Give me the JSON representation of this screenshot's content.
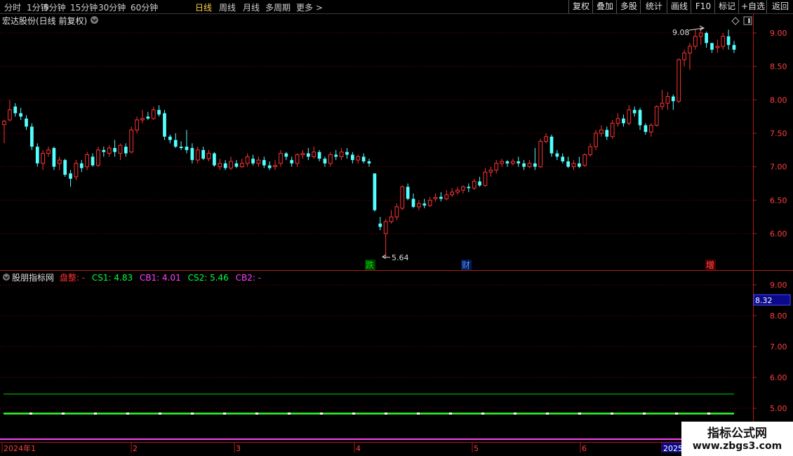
{
  "toolbar": {
    "timeframes": [
      {
        "label": "分时",
        "active": false
      },
      {
        "label": "1分钟",
        "active": false
      },
      {
        "label": "5分钟",
        "active": false
      },
      {
        "label": "15分钟",
        "active": false
      },
      {
        "label": "30分钟",
        "active": false
      },
      {
        "label": "60分钟",
        "active": false
      },
      {
        "label": "日线",
        "active": true
      },
      {
        "label": "周线",
        "active": false
      },
      {
        "label": "月线",
        "active": false
      },
      {
        "label": "多周期",
        "active": false
      },
      {
        "label": "更多 >",
        "active": false
      }
    ],
    "right_buttons": [
      "复权",
      "叠加",
      "多股",
      "统计",
      "画线",
      "F10",
      "+自选",
      "返回"
    ],
    "mark_label": "标记"
  },
  "main_panel": {
    "title": "宏达股份(日线 前复权)",
    "y_ticks": [
      "9.00",
      "8.50",
      "8.00",
      "7.50",
      "7.00",
      "6.50",
      "6.00"
    ],
    "high_annotation": "9.08",
    "low_annotation": "5.64",
    "markers": [
      {
        "text": "跌",
        "color": "#00c000"
      },
      {
        "text": "财",
        "color": "#2a6cff"
      },
      {
        "text": "增",
        "color": "#ff3030"
      }
    ]
  },
  "indicator_panel": {
    "name": "股朋指标网",
    "label_pan": "盘整:",
    "label_cs1": "CS1: 4.83",
    "label_cb1": "CB1: 4.01",
    "label_cs2": "CS2: 5.46",
    "label_cb2": "CB2:",
    "dash": "-",
    "y_ticks": [
      "9.00",
      "8.00",
      "7.00",
      "6.00",
      "5.00"
    ],
    "current_value": "8.32"
  },
  "x_axis": {
    "labels": [
      "2024年1",
      "2",
      "3",
      "4",
      "5",
      "6",
      "2025"
    ]
  },
  "watermark": {
    "line1": "指标公式网",
    "line2": "www.zbgs3.com"
  },
  "colors": {
    "up": "#ff3232",
    "down": "#54ffff",
    "grid": "#8b0000",
    "green_line": "#00d000",
    "magenta_line": "#ff40ff"
  },
  "chart_data": {
    "type": "candlestick",
    "y_range": [
      5.55,
      9.25
    ],
    "candles": [
      [
        7.63,
        7.68,
        7.35,
        7.7
      ],
      [
        7.7,
        7.85,
        7.68,
        8.0
      ],
      [
        7.9,
        7.8,
        7.75,
        7.95
      ],
      [
        7.8,
        7.75,
        7.7,
        7.88
      ],
      [
        7.72,
        7.6,
        7.55,
        7.77
      ],
      [
        7.6,
        7.3,
        7.25,
        7.65
      ],
      [
        7.3,
        7.05,
        7.0,
        7.35
      ],
      [
        7.05,
        7.2,
        6.95,
        7.25
      ],
      [
        7.2,
        7.25,
        7.15,
        7.3
      ],
      [
        7.28,
        7.0,
        6.95,
        7.3
      ],
      [
        7.05,
        7.1,
        6.95,
        7.15
      ],
      [
        7.1,
        6.88,
        6.85,
        7.12
      ],
      [
        6.9,
        6.82,
        6.7,
        6.95
      ],
      [
        6.85,
        7.05,
        6.8,
        7.1
      ],
      [
        7.05,
        6.98,
        6.92,
        7.1
      ],
      [
        7.0,
        7.18,
        6.95,
        7.22
      ],
      [
        7.15,
        7.02,
        7.0,
        7.2
      ],
      [
        7.02,
        7.25,
        7.0,
        7.3
      ],
      [
        7.25,
        7.22,
        7.15,
        7.3
      ],
      [
        7.2,
        7.28,
        7.15,
        7.32
      ],
      [
        7.28,
        7.22,
        7.15,
        7.4
      ],
      [
        7.2,
        7.32,
        7.1,
        7.35
      ],
      [
        7.3,
        7.2,
        7.15,
        7.35
      ],
      [
        7.22,
        7.55,
        7.2,
        7.6
      ],
      [
        7.55,
        7.7,
        7.5,
        7.75
      ],
      [
        7.7,
        7.72,
        7.65,
        7.85
      ],
      [
        7.75,
        7.72,
        7.7,
        7.82
      ],
      [
        7.72,
        7.85,
        7.7,
        7.9
      ],
      [
        7.85,
        7.78,
        7.75,
        7.92
      ],
      [
        7.8,
        7.45,
        7.4,
        7.85
      ],
      [
        7.45,
        7.4,
        7.35,
        7.48
      ],
      [
        7.4,
        7.3,
        7.28,
        7.5
      ],
      [
        7.3,
        7.28,
        7.25,
        7.38
      ],
      [
        7.3,
        7.25,
        7.2,
        7.55
      ],
      [
        7.28,
        7.1,
        7.05,
        7.35
      ],
      [
        7.1,
        7.25,
        7.05,
        7.3
      ],
      [
        7.25,
        7.12,
        7.1,
        7.3
      ],
      [
        7.12,
        7.2,
        7.08,
        7.25
      ],
      [
        7.2,
        7.02,
        7.0,
        7.22
      ],
      [
        7.0,
        7.05,
        6.95,
        7.12
      ],
      [
        7.05,
        6.98,
        6.95,
        7.1
      ],
      [
        6.98,
        7.08,
        6.95,
        7.15
      ],
      [
        7.05,
        7.0,
        6.98,
        7.1
      ],
      [
        7.0,
        7.05,
        6.98,
        7.12
      ],
      [
        7.05,
        7.15,
        7.0,
        7.2
      ],
      [
        7.12,
        7.05,
        7.02,
        7.18
      ],
      [
        7.05,
        7.1,
        7.0,
        7.15
      ],
      [
        7.1,
        7.02,
        6.98,
        7.15
      ],
      [
        7.02,
        6.98,
        6.95,
        7.08
      ],
      [
        7.0,
        7.02,
        6.95,
        7.1
      ],
      [
        7.05,
        7.2,
        7.0,
        7.25
      ],
      [
        7.2,
        7.15,
        7.1,
        7.22
      ],
      [
        7.1,
        7.05,
        7.0,
        7.15
      ],
      [
        7.05,
        7.18,
        7.0,
        7.2
      ],
      [
        7.18,
        7.2,
        7.12,
        7.25
      ],
      [
        7.2,
        7.15,
        7.1,
        7.28
      ],
      [
        7.15,
        7.22,
        7.12,
        7.3
      ],
      [
        7.22,
        7.12,
        7.08,
        7.25
      ],
      [
        7.12,
        7.05,
        7.0,
        7.15
      ],
      [
        7.05,
        7.18,
        7.0,
        7.22
      ],
      [
        7.18,
        7.15,
        7.1,
        7.25
      ],
      [
        7.15,
        7.22,
        7.1,
        7.28
      ],
      [
        7.22,
        7.18,
        7.12,
        7.28
      ],
      [
        7.18,
        7.1,
        7.05,
        7.22
      ],
      [
        7.1,
        7.15,
        7.05,
        7.18
      ],
      [
        7.15,
        7.08,
        7.05,
        7.2
      ],
      [
        7.08,
        7.05,
        7.0,
        7.12
      ],
      [
        6.9,
        6.35,
        6.33,
        6.9
      ],
      [
        6.15,
        6.1,
        6.05,
        6.25
      ],
      [
        6.0,
        6.18,
        5.64,
        6.22
      ],
      [
        6.18,
        6.25,
        6.15,
        6.35
      ],
      [
        6.25,
        6.4,
        6.2,
        6.45
      ],
      [
        6.38,
        6.7,
        6.35,
        6.72
      ],
      [
        6.7,
        6.52,
        6.5,
        6.75
      ],
      [
        6.52,
        6.4,
        6.38,
        6.6
      ],
      [
        6.4,
        6.45,
        6.35,
        6.5
      ],
      [
        6.45,
        6.42,
        6.38,
        6.52
      ],
      [
        6.42,
        6.5,
        6.4,
        6.55
      ],
      [
        6.52,
        6.54,
        6.48,
        6.6
      ],
      [
        6.55,
        6.52,
        6.48,
        6.62
      ],
      [
        6.52,
        6.58,
        6.5,
        6.65
      ],
      [
        6.58,
        6.62,
        6.55,
        6.68
      ],
      [
        6.62,
        6.65,
        6.58,
        6.7
      ],
      [
        6.65,
        6.7,
        6.6,
        6.72
      ],
      [
        6.7,
        6.68,
        6.62,
        6.75
      ],
      [
        6.68,
        6.78,
        6.65,
        6.82
      ],
      [
        6.78,
        6.72,
        6.7,
        6.85
      ],
      [
        6.72,
        6.92,
        6.7,
        6.98
      ],
      [
        6.92,
        6.95,
        6.85,
        7.0
      ],
      [
        6.95,
        7.05,
        6.9,
        7.1
      ],
      [
        7.05,
        7.08,
        7.0,
        7.12
      ],
      [
        7.08,
        7.05,
        7.0,
        7.1
      ],
      [
        7.05,
        7.08,
        7.02,
        7.12
      ],
      [
        7.08,
        7.05,
        7.0,
        7.15
      ],
      [
        7.05,
        7.0,
        6.95,
        7.1
      ],
      [
        7.0,
        7.05,
        6.98,
        7.1
      ],
      [
        7.05,
        7.0,
        6.95,
        7.28
      ],
      [
        7.0,
        7.38,
        6.98,
        7.42
      ],
      [
        7.38,
        7.45,
        7.35,
        7.5
      ],
      [
        7.45,
        7.2,
        7.15,
        7.48
      ],
      [
        7.2,
        7.15,
        7.1,
        7.25
      ],
      [
        7.15,
        7.08,
        7.05,
        7.2
      ],
      [
        7.08,
        7.0,
        6.98,
        7.15
      ],
      [
        7.0,
        7.05,
        6.95,
        7.1
      ],
      [
        7.05,
        7.0,
        6.98,
        7.15
      ],
      [
        7.02,
        7.18,
        7.0,
        7.2
      ],
      [
        7.18,
        7.3,
        7.15,
        7.35
      ],
      [
        7.3,
        7.5,
        7.25,
        7.55
      ],
      [
        7.5,
        7.55,
        7.45,
        7.62
      ],
      [
        7.55,
        7.45,
        7.4,
        7.6
      ],
      [
        7.45,
        7.65,
        7.42,
        7.7
      ],
      [
        7.65,
        7.72,
        7.6,
        7.8
      ],
      [
        7.72,
        7.65,
        7.6,
        7.78
      ],
      [
        7.65,
        7.85,
        7.62,
        7.92
      ],
      [
        7.85,
        7.8,
        7.75,
        7.9
      ],
      [
        7.85,
        7.62,
        7.55,
        7.88
      ],
      [
        7.62,
        7.52,
        7.48,
        7.65
      ],
      [
        7.52,
        7.62,
        7.45,
        7.65
      ],
      [
        7.62,
        7.9,
        7.6,
        7.92
      ],
      [
        7.9,
        7.95,
        7.85,
        8.15
      ],
      [
        7.95,
        8.05,
        7.85,
        8.12
      ],
      [
        8.05,
        7.98,
        7.85,
        8.08
      ],
      [
        7.98,
        8.6,
        7.95,
        8.62
      ],
      [
        8.6,
        8.7,
        8.5,
        8.75
      ],
      [
        8.7,
        8.8,
        8.45,
        8.85
      ],
      [
        8.8,
        8.95,
        8.75,
        9.05
      ],
      [
        8.95,
        9.0,
        8.82,
        9.08
      ],
      [
        9.0,
        8.85,
        8.78,
        9.02
      ],
      [
        8.85,
        8.75,
        8.7,
        8.85
      ],
      [
        8.78,
        8.8,
        8.7,
        8.9
      ],
      [
        8.8,
        8.95,
        8.75,
        9.0
      ],
      [
        8.95,
        8.82,
        8.75,
        9.05
      ],
      [
        8.82,
        8.75,
        8.7,
        8.88
      ]
    ],
    "indicator_lines": {
      "CS1": 4.83,
      "CS2": 5.46,
      "CB1": 4.01
    }
  }
}
